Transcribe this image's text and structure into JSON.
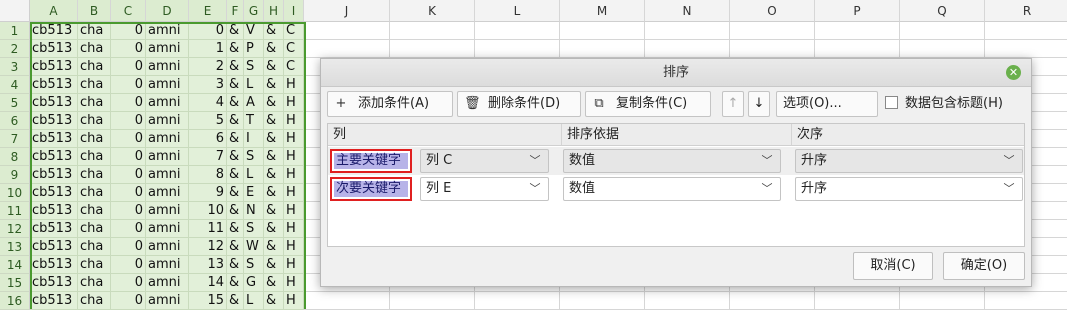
{
  "sheet": {
    "columns": [
      "A",
      "B",
      "C",
      "D",
      "E",
      "F",
      "G",
      "H",
      "I",
      "J",
      "K",
      "L",
      "M",
      "N",
      "O",
      "P",
      "Q",
      "R"
    ],
    "rows": [
      {
        "n": "1",
        "a": "cb513",
        "b": "cha",
        "c": "0",
        "d": "amni",
        "e": "0",
        "f": "&",
        "g": "V",
        "h": "&",
        "i": "C"
      },
      {
        "n": "2",
        "a": "cb513",
        "b": "cha",
        "c": "0",
        "d": "amni",
        "e": "1",
        "f": "&",
        "g": "P",
        "h": "&",
        "i": "C"
      },
      {
        "n": "3",
        "a": "cb513",
        "b": "cha",
        "c": "0",
        "d": "amni",
        "e": "2",
        "f": "&",
        "g": "S",
        "h": "&",
        "i": "C"
      },
      {
        "n": "4",
        "a": "cb513",
        "b": "cha",
        "c": "0",
        "d": "amni",
        "e": "3",
        "f": "&",
        "g": "L",
        "h": "&",
        "i": "H"
      },
      {
        "n": "5",
        "a": "cb513",
        "b": "cha",
        "c": "0",
        "d": "amni",
        "e": "4",
        "f": "&",
        "g": "A",
        "h": "&",
        "i": "H"
      },
      {
        "n": "6",
        "a": "cb513",
        "b": "cha",
        "c": "0",
        "d": "amni",
        "e": "5",
        "f": "&",
        "g": "T",
        "h": "&",
        "i": "H"
      },
      {
        "n": "7",
        "a": "cb513",
        "b": "cha",
        "c": "0",
        "d": "amni",
        "e": "6",
        "f": "&",
        "g": "I",
        "h": "&",
        "i": "H"
      },
      {
        "n": "8",
        "a": "cb513",
        "b": "cha",
        "c": "0",
        "d": "amni",
        "e": "7",
        "f": "&",
        "g": "S",
        "h": "&",
        "i": "H"
      },
      {
        "n": "9",
        "a": "cb513",
        "b": "cha",
        "c": "0",
        "d": "amni",
        "e": "8",
        "f": "&",
        "g": "L",
        "h": "&",
        "i": "H"
      },
      {
        "n": "10",
        "a": "cb513",
        "b": "cha",
        "c": "0",
        "d": "amni",
        "e": "9",
        "f": "&",
        "g": "E",
        "h": "&",
        "i": "H"
      },
      {
        "n": "11",
        "a": "cb513",
        "b": "cha",
        "c": "0",
        "d": "amni",
        "e": "10",
        "f": "&",
        "g": "N",
        "h": "&",
        "i": "H"
      },
      {
        "n": "12",
        "a": "cb513",
        "b": "cha",
        "c": "0",
        "d": "amni",
        "e": "11",
        "f": "&",
        "g": "S",
        "h": "&",
        "i": "H"
      },
      {
        "n": "13",
        "a": "cb513",
        "b": "cha",
        "c": "0",
        "d": "amni",
        "e": "12",
        "f": "&",
        "g": "W",
        "h": "&",
        "i": "H"
      },
      {
        "n": "14",
        "a": "cb513",
        "b": "cha",
        "c": "0",
        "d": "amni",
        "e": "13",
        "f": "&",
        "g": "S",
        "h": "&",
        "i": "H"
      },
      {
        "n": "15",
        "a": "cb513",
        "b": "cha",
        "c": "0",
        "d": "amni",
        "e": "14",
        "f": "&",
        "g": "G",
        "h": "&",
        "i": "H"
      },
      {
        "n": "16",
        "a": "cb513",
        "b": "cha",
        "c": "0",
        "d": "amni",
        "e": "15",
        "f": "&",
        "g": "L",
        "h": "&",
        "i": "H"
      }
    ]
  },
  "dialog": {
    "title": "排序",
    "toolbar": {
      "add_label": "添加条件(A)",
      "delete_label": "删除条件(D)",
      "copy_label": "复制条件(C)",
      "up_glyph": "↑",
      "down_glyph": "↓",
      "options_label": "选项(O)...",
      "header_checkbox_label": "数据包含标题(H)"
    },
    "grid": {
      "headers": {
        "column": "列",
        "sort_on": "排序依据",
        "order": "次序"
      },
      "rows": [
        {
          "key_label": "主要关键字",
          "column": "列 C",
          "sort_on": "数值",
          "order": "升序"
        },
        {
          "key_label": "次要关键字",
          "column": "列 E",
          "sort_on": "数值",
          "order": "升序"
        }
      ]
    },
    "cancel_label": "取消(C)",
    "ok_label": "确定(O)"
  },
  "colors": {
    "selection_border": "#4a9a2f",
    "selection_fill": "#e2f0d9",
    "key_highlight": "#b7b3e8",
    "key_border": "#e02020"
  }
}
